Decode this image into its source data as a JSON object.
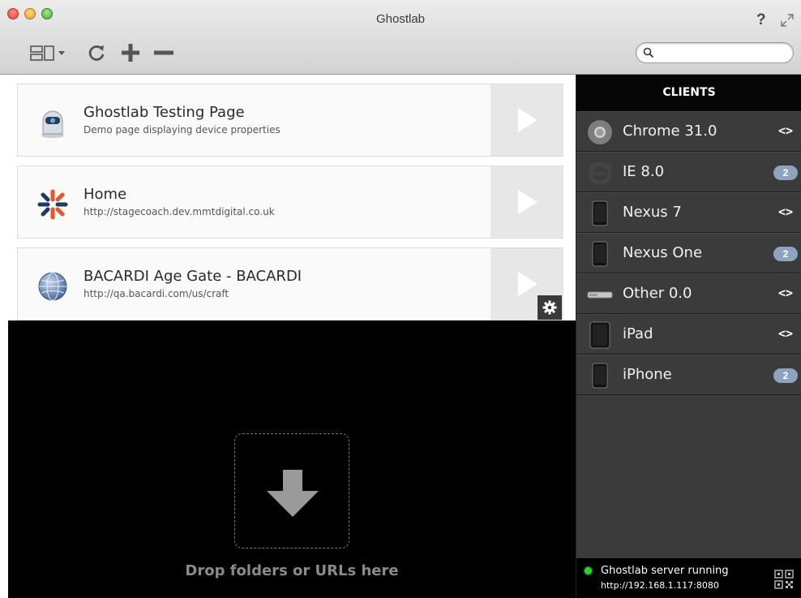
{
  "window": {
    "title": "Ghostlab",
    "help_label": "?"
  },
  "toolbar": {
    "layout_icon": "layout-icon",
    "refresh_icon": "refresh-icon",
    "add_icon": "plus-icon",
    "remove_icon": "minus-icon",
    "search_placeholder": "",
    "search_value": ""
  },
  "projects": [
    {
      "title": "Ghostlab Testing Page",
      "subtitle": "Demo page displaying device properties",
      "icon": "ghost-icon"
    },
    {
      "title": "Home",
      "subtitle": "http://stagecoach.dev.mmtdigital.co.uk",
      "icon": "asterisk-logo-icon"
    },
    {
      "title": "BACARDI Age Gate - BACARDI",
      "subtitle": "http://qa.bacardi.com/us/craft",
      "icon": "globe-icon"
    }
  ],
  "dropzone": {
    "label": "Drop folders or URLs here"
  },
  "clients": {
    "header": "CLIENTS",
    "items": [
      {
        "name": "Chrome 31.0",
        "icon": "chrome-icon",
        "action": "<>",
        "badge": null
      },
      {
        "name": "IE 8.0",
        "icon": "ie-icon",
        "action": null,
        "badge": "2"
      },
      {
        "name": "Nexus 7",
        "icon": "phone-icon",
        "action": "<>",
        "badge": null
      },
      {
        "name": "Nexus One",
        "icon": "phone-icon",
        "action": null,
        "badge": "2"
      },
      {
        "name": "Other 0.0",
        "icon": "device-icon",
        "action": "<>",
        "badge": null
      },
      {
        "name": "iPad",
        "icon": "tablet-icon",
        "action": "<>",
        "badge": null
      },
      {
        "name": "iPhone",
        "icon": "phone-icon",
        "action": null,
        "badge": "2"
      }
    ]
  },
  "status": {
    "text": "Ghostlab server running",
    "url": "http://192.168.1.117:8080",
    "color": "#2ecf2e"
  }
}
